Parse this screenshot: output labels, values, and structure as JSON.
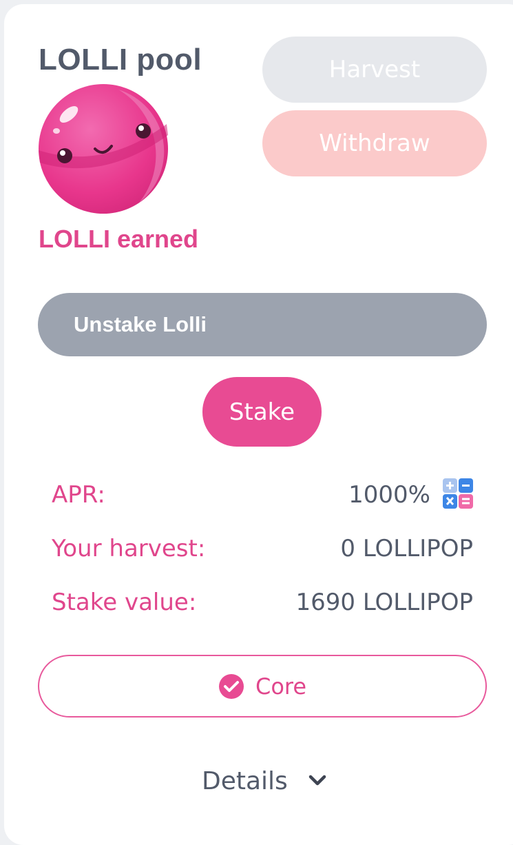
{
  "pool": {
    "title": "LOLLI pool",
    "earned_label": "LOLLI earned"
  },
  "actions": {
    "harvest_label": "Harvest",
    "withdraw_label": "Withdraw",
    "unstake_label": "Unstake Lolli",
    "stake_label": "Stake"
  },
  "stats": {
    "apr_label": "APR:",
    "apr_value": "1000%",
    "harvest_label": "Your harvest:",
    "harvest_value": "0 LOLLIPOP",
    "stake_value_label": "Stake value:",
    "stake_value": "1690 LOLLIPOP"
  },
  "badge": {
    "label": "Core",
    "icon": "check-circle-icon"
  },
  "details": {
    "label": "Details",
    "icon": "chevron-down-icon"
  },
  "colors": {
    "accent_pink": "#e84b93",
    "text_gray": "#525a6a",
    "disabled_gray": "#e6e8ec",
    "withdraw_pink": "#fbcaca",
    "unstake_gray": "#9ca3af"
  }
}
